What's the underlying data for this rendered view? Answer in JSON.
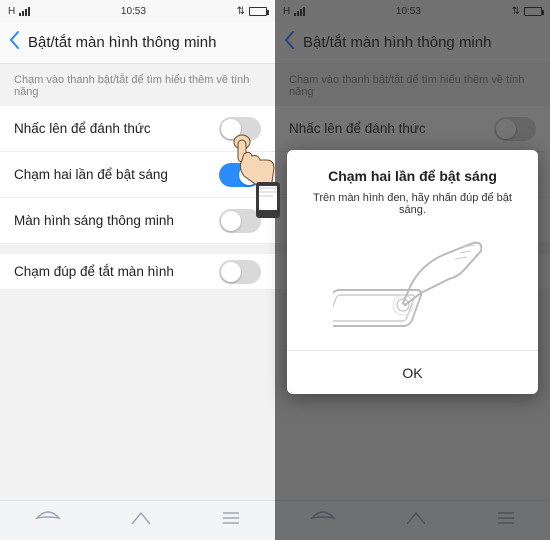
{
  "statusbar": {
    "network": "H",
    "time": "10:53"
  },
  "header": {
    "title": "Bật/tắt màn hình thông minh"
  },
  "hint": "Chạm vào thanh bật/tắt để tìm hiểu thêm về tính năng",
  "settings": [
    {
      "label": "Nhấc lên để đánh thức",
      "on": false
    },
    {
      "label": "Chạm hai lần để bật sáng",
      "on": true
    },
    {
      "label": "Màn hình sáng thông minh",
      "on": false
    },
    {
      "label": "Chạm đúp để tắt màn hình",
      "on": false
    }
  ],
  "dialog": {
    "title": "Chạm hai lần để bật sáng",
    "text": "Trên màn hình đen, hãy nhấn đúp để bật sáng.",
    "ok": "OK"
  }
}
